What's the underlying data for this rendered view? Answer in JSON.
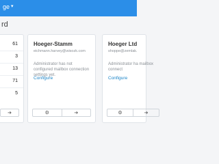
{
  "topbar": {
    "nav_label": "ge",
    "caret_icon": "chevron-down-icon"
  },
  "page": {
    "title": "rd"
  },
  "left_card": {
    "numbers": [
      "61",
      "3",
      "13",
      "71",
      "5"
    ]
  },
  "cards": [
    {
      "name": "Hoeger-Stamm",
      "email": "eichmann.harvey@wisozk.com",
      "message": "Administrator has not configured mailbox connection settings yet.",
      "link": "Configure"
    },
    {
      "name": "Hoeger Ltd",
      "email": "shoppe@zemlak.",
      "message": "Administrator ha mailbox connect",
      "link": "Configure"
    }
  ],
  "icons": {
    "settings": "gear-icon",
    "next": "arrow-right-icon"
  }
}
